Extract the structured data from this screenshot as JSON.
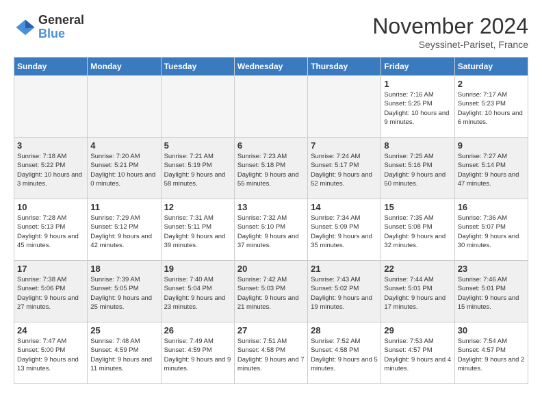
{
  "header": {
    "logo_line1": "General",
    "logo_line2": "Blue",
    "month": "November 2024",
    "location": "Seyssinet-Pariset, France"
  },
  "weekdays": [
    "Sunday",
    "Monday",
    "Tuesday",
    "Wednesday",
    "Thursday",
    "Friday",
    "Saturday"
  ],
  "weeks": [
    [
      {
        "day": "",
        "info": ""
      },
      {
        "day": "",
        "info": ""
      },
      {
        "day": "",
        "info": ""
      },
      {
        "day": "",
        "info": ""
      },
      {
        "day": "",
        "info": ""
      },
      {
        "day": "1",
        "info": "Sunrise: 7:16 AM\nSunset: 5:25 PM\nDaylight: 10 hours and 9 minutes."
      },
      {
        "day": "2",
        "info": "Sunrise: 7:17 AM\nSunset: 5:23 PM\nDaylight: 10 hours and 6 minutes."
      }
    ],
    [
      {
        "day": "3",
        "info": "Sunrise: 7:18 AM\nSunset: 5:22 PM\nDaylight: 10 hours and 3 minutes."
      },
      {
        "day": "4",
        "info": "Sunrise: 7:20 AM\nSunset: 5:21 PM\nDaylight: 10 hours and 0 minutes."
      },
      {
        "day": "5",
        "info": "Sunrise: 7:21 AM\nSunset: 5:19 PM\nDaylight: 9 hours and 58 minutes."
      },
      {
        "day": "6",
        "info": "Sunrise: 7:23 AM\nSunset: 5:18 PM\nDaylight: 9 hours and 55 minutes."
      },
      {
        "day": "7",
        "info": "Sunrise: 7:24 AM\nSunset: 5:17 PM\nDaylight: 9 hours and 52 minutes."
      },
      {
        "day": "8",
        "info": "Sunrise: 7:25 AM\nSunset: 5:16 PM\nDaylight: 9 hours and 50 minutes."
      },
      {
        "day": "9",
        "info": "Sunrise: 7:27 AM\nSunset: 5:14 PM\nDaylight: 9 hours and 47 minutes."
      }
    ],
    [
      {
        "day": "10",
        "info": "Sunrise: 7:28 AM\nSunset: 5:13 PM\nDaylight: 9 hours and 45 minutes."
      },
      {
        "day": "11",
        "info": "Sunrise: 7:29 AM\nSunset: 5:12 PM\nDaylight: 9 hours and 42 minutes."
      },
      {
        "day": "12",
        "info": "Sunrise: 7:31 AM\nSunset: 5:11 PM\nDaylight: 9 hours and 39 minutes."
      },
      {
        "day": "13",
        "info": "Sunrise: 7:32 AM\nSunset: 5:10 PM\nDaylight: 9 hours and 37 minutes."
      },
      {
        "day": "14",
        "info": "Sunrise: 7:34 AM\nSunset: 5:09 PM\nDaylight: 9 hours and 35 minutes."
      },
      {
        "day": "15",
        "info": "Sunrise: 7:35 AM\nSunset: 5:08 PM\nDaylight: 9 hours and 32 minutes."
      },
      {
        "day": "16",
        "info": "Sunrise: 7:36 AM\nSunset: 5:07 PM\nDaylight: 9 hours and 30 minutes."
      }
    ],
    [
      {
        "day": "17",
        "info": "Sunrise: 7:38 AM\nSunset: 5:06 PM\nDaylight: 9 hours and 27 minutes."
      },
      {
        "day": "18",
        "info": "Sunrise: 7:39 AM\nSunset: 5:05 PM\nDaylight: 9 hours and 25 minutes."
      },
      {
        "day": "19",
        "info": "Sunrise: 7:40 AM\nSunset: 5:04 PM\nDaylight: 9 hours and 23 minutes."
      },
      {
        "day": "20",
        "info": "Sunrise: 7:42 AM\nSunset: 5:03 PM\nDaylight: 9 hours and 21 minutes."
      },
      {
        "day": "21",
        "info": "Sunrise: 7:43 AM\nSunset: 5:02 PM\nDaylight: 9 hours and 19 minutes."
      },
      {
        "day": "22",
        "info": "Sunrise: 7:44 AM\nSunset: 5:01 PM\nDaylight: 9 hours and 17 minutes."
      },
      {
        "day": "23",
        "info": "Sunrise: 7:46 AM\nSunset: 5:01 PM\nDaylight: 9 hours and 15 minutes."
      }
    ],
    [
      {
        "day": "24",
        "info": "Sunrise: 7:47 AM\nSunset: 5:00 PM\nDaylight: 9 hours and 13 minutes."
      },
      {
        "day": "25",
        "info": "Sunrise: 7:48 AM\nSunset: 4:59 PM\nDaylight: 9 hours and 11 minutes."
      },
      {
        "day": "26",
        "info": "Sunrise: 7:49 AM\nSunset: 4:59 PM\nDaylight: 9 hours and 9 minutes."
      },
      {
        "day": "27",
        "info": "Sunrise: 7:51 AM\nSunset: 4:58 PM\nDaylight: 9 hours and 7 minutes."
      },
      {
        "day": "28",
        "info": "Sunrise: 7:52 AM\nSunset: 4:58 PM\nDaylight: 9 hours and 5 minutes."
      },
      {
        "day": "29",
        "info": "Sunrise: 7:53 AM\nSunset: 4:57 PM\nDaylight: 9 hours and 4 minutes."
      },
      {
        "day": "30",
        "info": "Sunrise: 7:54 AM\nSunset: 4:57 PM\nDaylight: 9 hours and 2 minutes."
      }
    ]
  ]
}
